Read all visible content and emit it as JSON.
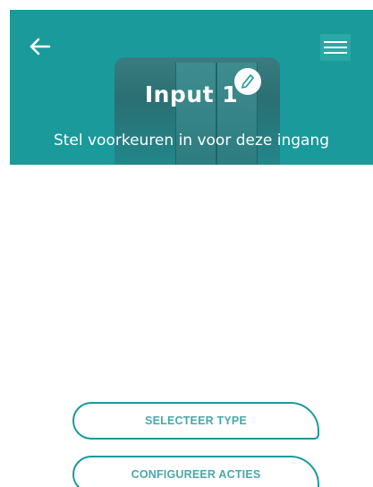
{
  "header": {
    "title": "Input 1",
    "subtitle": "Stel voorkeuren in voor deze ingang",
    "back_icon": "arrow-left-icon",
    "menu_icon": "hamburger-menu-icon",
    "edit_icon": "pencil-icon",
    "background_color": "#1a9a9b"
  },
  "actions": {
    "select_type_label": "SELECTEER TYPE",
    "configure_actions_label": "CONFIGUREER ACTIES",
    "accent_color": "#1a9a9b"
  }
}
